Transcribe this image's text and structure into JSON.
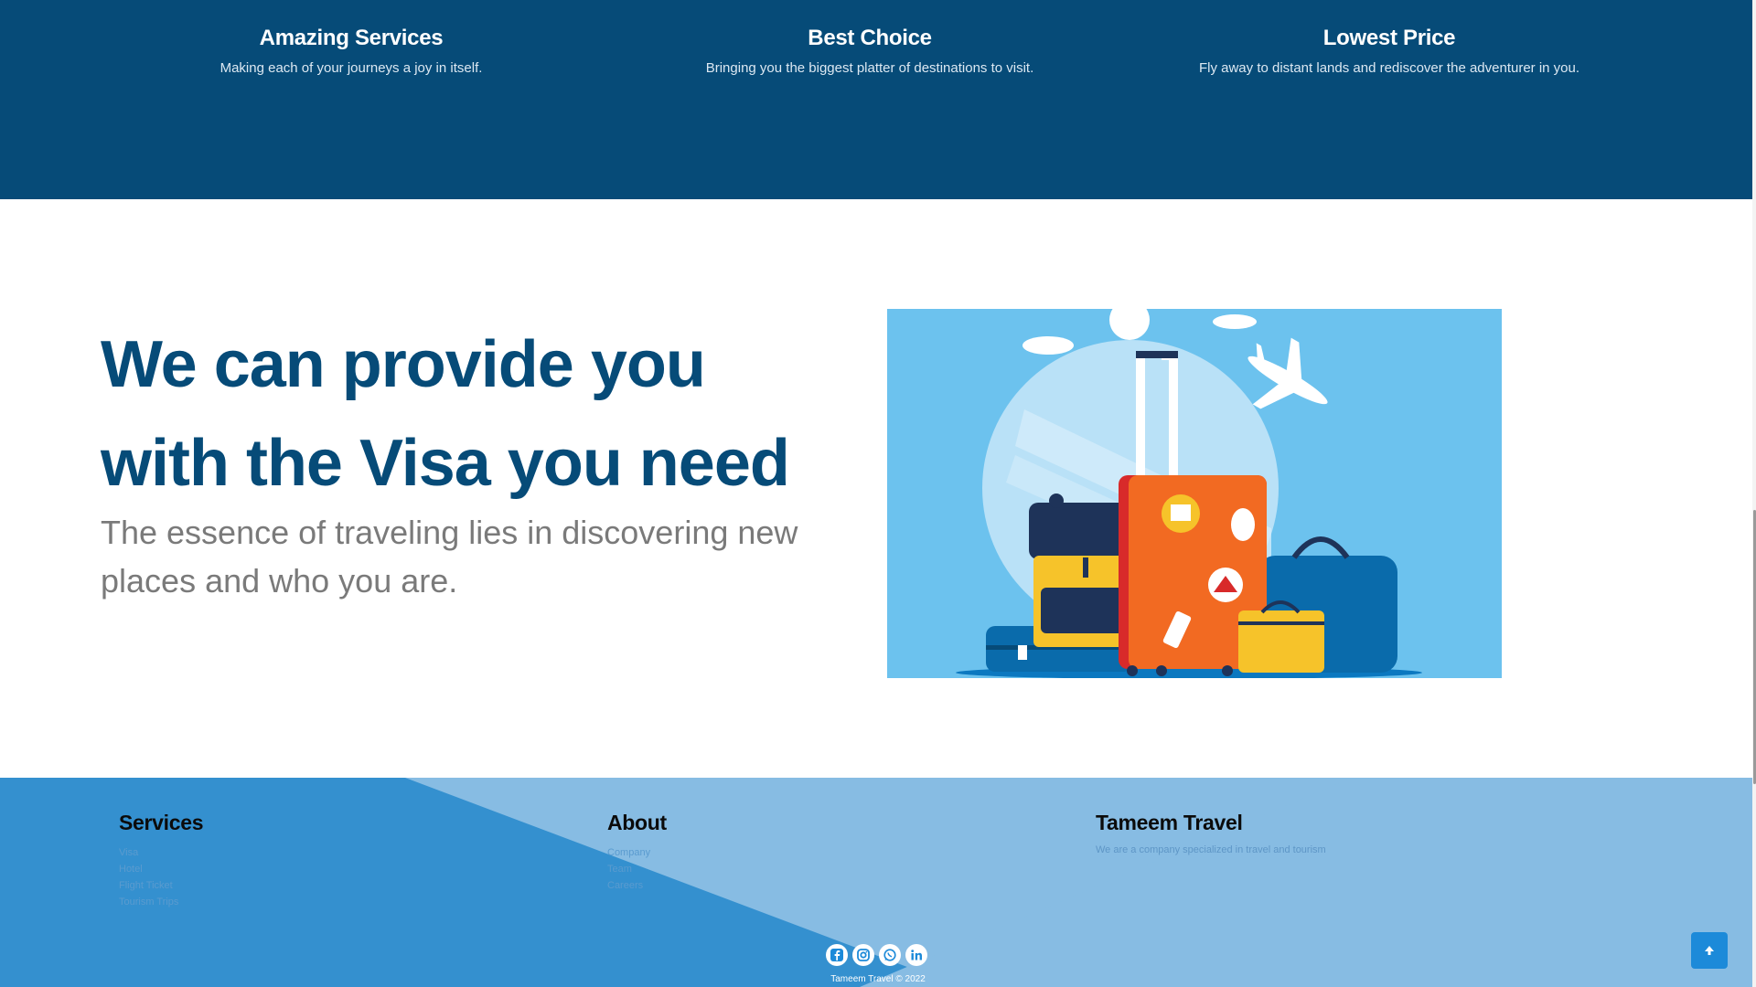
{
  "features": [
    {
      "title": "Amazing Services",
      "text": "Making each of your journeys a joy in itself."
    },
    {
      "title": "Best Choice",
      "text": "Bringing you the biggest platter of destinations to visit."
    },
    {
      "title": "Lowest Price",
      "text": "Fly away to distant lands and rediscover the adventurer in you."
    }
  ],
  "hero": {
    "title": "We can provide you with the Visa you need",
    "subtitle": "The essence of traveling lies in discovering new places and who you are."
  },
  "footer": {
    "services": {
      "heading": "Services",
      "items": [
        "Visa",
        "Hotel",
        "Flight Ticket",
        "Tourism Trips"
      ]
    },
    "about": {
      "heading": "About",
      "items": [
        "Company",
        "Team",
        "Careers"
      ]
    },
    "brand": {
      "heading": "Tameem Travel",
      "text": "We are a company specialized in travel and tourism"
    },
    "socials": [
      "facebook-icon",
      "instagram-icon",
      "whatsapp-icon",
      "linkedin-icon"
    ],
    "copyright": "Tameem Travel © 2022"
  },
  "colors": {
    "primary": "#064b78",
    "footer_dark": "#3490cf",
    "footer_light": "#87bce3",
    "accent": "#1c8ad9"
  }
}
